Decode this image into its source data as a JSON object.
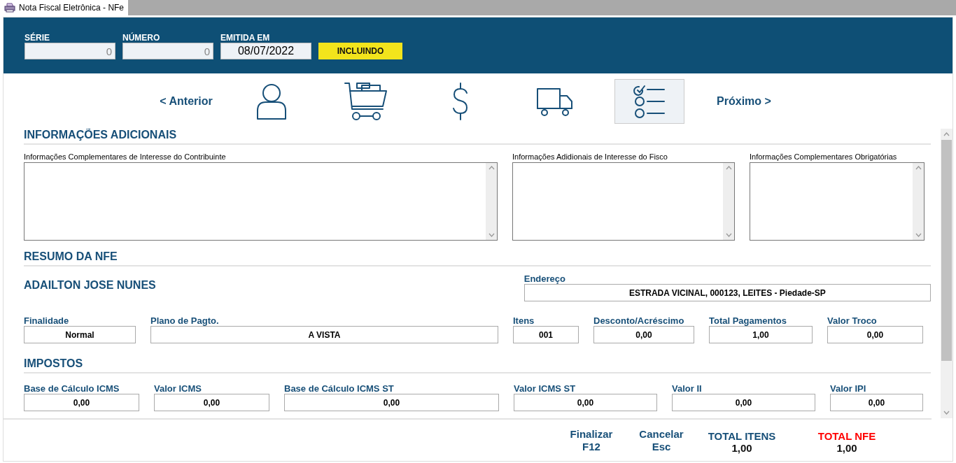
{
  "window": {
    "title": "Nota Fiscal Eletrônica - NFe"
  },
  "header": {
    "fields": [
      {
        "label": "SÉRIE",
        "value": "0",
        "kind": "number"
      },
      {
        "label": "NÚMERO",
        "value": "0",
        "kind": "number"
      },
      {
        "label": "EMITIDA EM",
        "value": "08/07/2022",
        "kind": "date"
      }
    ],
    "status": "INCLUINDO"
  },
  "nav": {
    "previous": "< Anterior",
    "next": "Próximo >",
    "steps": [
      {
        "kind": "customer",
        "selected": false
      },
      {
        "kind": "products",
        "selected": false
      },
      {
        "kind": "payment",
        "selected": false
      },
      {
        "kind": "shipping",
        "selected": false
      },
      {
        "kind": "summary",
        "selected": true
      }
    ]
  },
  "info": {
    "title": "INFORMAÇÕES ADICIONAIS",
    "notes": [
      {
        "label": "Informações Complementares de Interesse do Contribuinte"
      },
      {
        "label": "Informações Adidionais de Interesse do Fisco"
      },
      {
        "label": "Informações Complementares Obrigatórias"
      }
    ]
  },
  "summary": {
    "title": "RESUMO DA NFE",
    "customer": "ADAILTON JOSE NUNES",
    "address": {
      "label": "Endereço",
      "value": "ESTRADA VICINAL, 000123, LEITES - Piedade-SP"
    },
    "fields": [
      {
        "label": "Finalidade",
        "value": "Normal"
      },
      {
        "label": "Plano de Pagto.",
        "value": "A VISTA"
      },
      {
        "label": "Itens",
        "value": "001"
      },
      {
        "label": "Desconto/Acréscimo",
        "value": "0,00"
      },
      {
        "label": "Total Pagamentos",
        "value": "1,00"
      },
      {
        "label": "Valor Troco",
        "value": "0,00"
      }
    ]
  },
  "taxes": {
    "title": "IMPOSTOS",
    "fields": [
      {
        "label": "Base de Cálculo ICMS",
        "value": "0,00"
      },
      {
        "label": "Valor ICMS",
        "value": "0,00"
      },
      {
        "label": "Base de Cálculo ICMS ST",
        "value": "0,00"
      },
      {
        "label": "Valor ICMS ST",
        "value": "0,00"
      },
      {
        "label": "Valor II",
        "value": "0,00"
      },
      {
        "label": "Valor IPI",
        "value": "0,00"
      }
    ]
  },
  "footer": {
    "actions": [
      {
        "label": "Finalizar",
        "key": "F12"
      },
      {
        "label": "Cancelar",
        "key": "Esc"
      }
    ],
    "totals": [
      {
        "label": "TOTAL ITENS",
        "value": "1,00",
        "kind": "normal"
      },
      {
        "label": "TOTAL NFE",
        "value": "1,00",
        "kind": "alert"
      }
    ]
  }
}
